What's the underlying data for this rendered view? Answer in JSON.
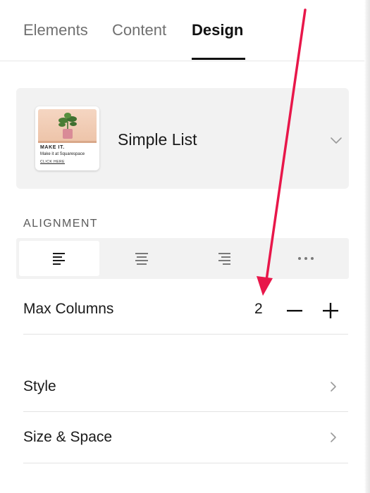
{
  "tabs": {
    "elements": "Elements",
    "content": "Content",
    "design": "Design"
  },
  "preset": {
    "name": "Simple List",
    "thumbnail": {
      "heading": "MAKE IT.",
      "subheading": "Make it at Squarespace",
      "link": "CLICK HERE"
    }
  },
  "alignment": {
    "label": "ALIGNMENT",
    "options": [
      "align-left",
      "align-center",
      "align-right",
      "more"
    ],
    "selected": "align-left"
  },
  "max_columns": {
    "label": "Max Columns",
    "value": "2"
  },
  "rows": {
    "style": "Style",
    "size_space": "Size & Space"
  },
  "colors": {
    "accent_arrow": "#e8174a",
    "active_tab": "#111111",
    "inactive_tab": "#707070",
    "card_bg": "#f2f2f2"
  }
}
